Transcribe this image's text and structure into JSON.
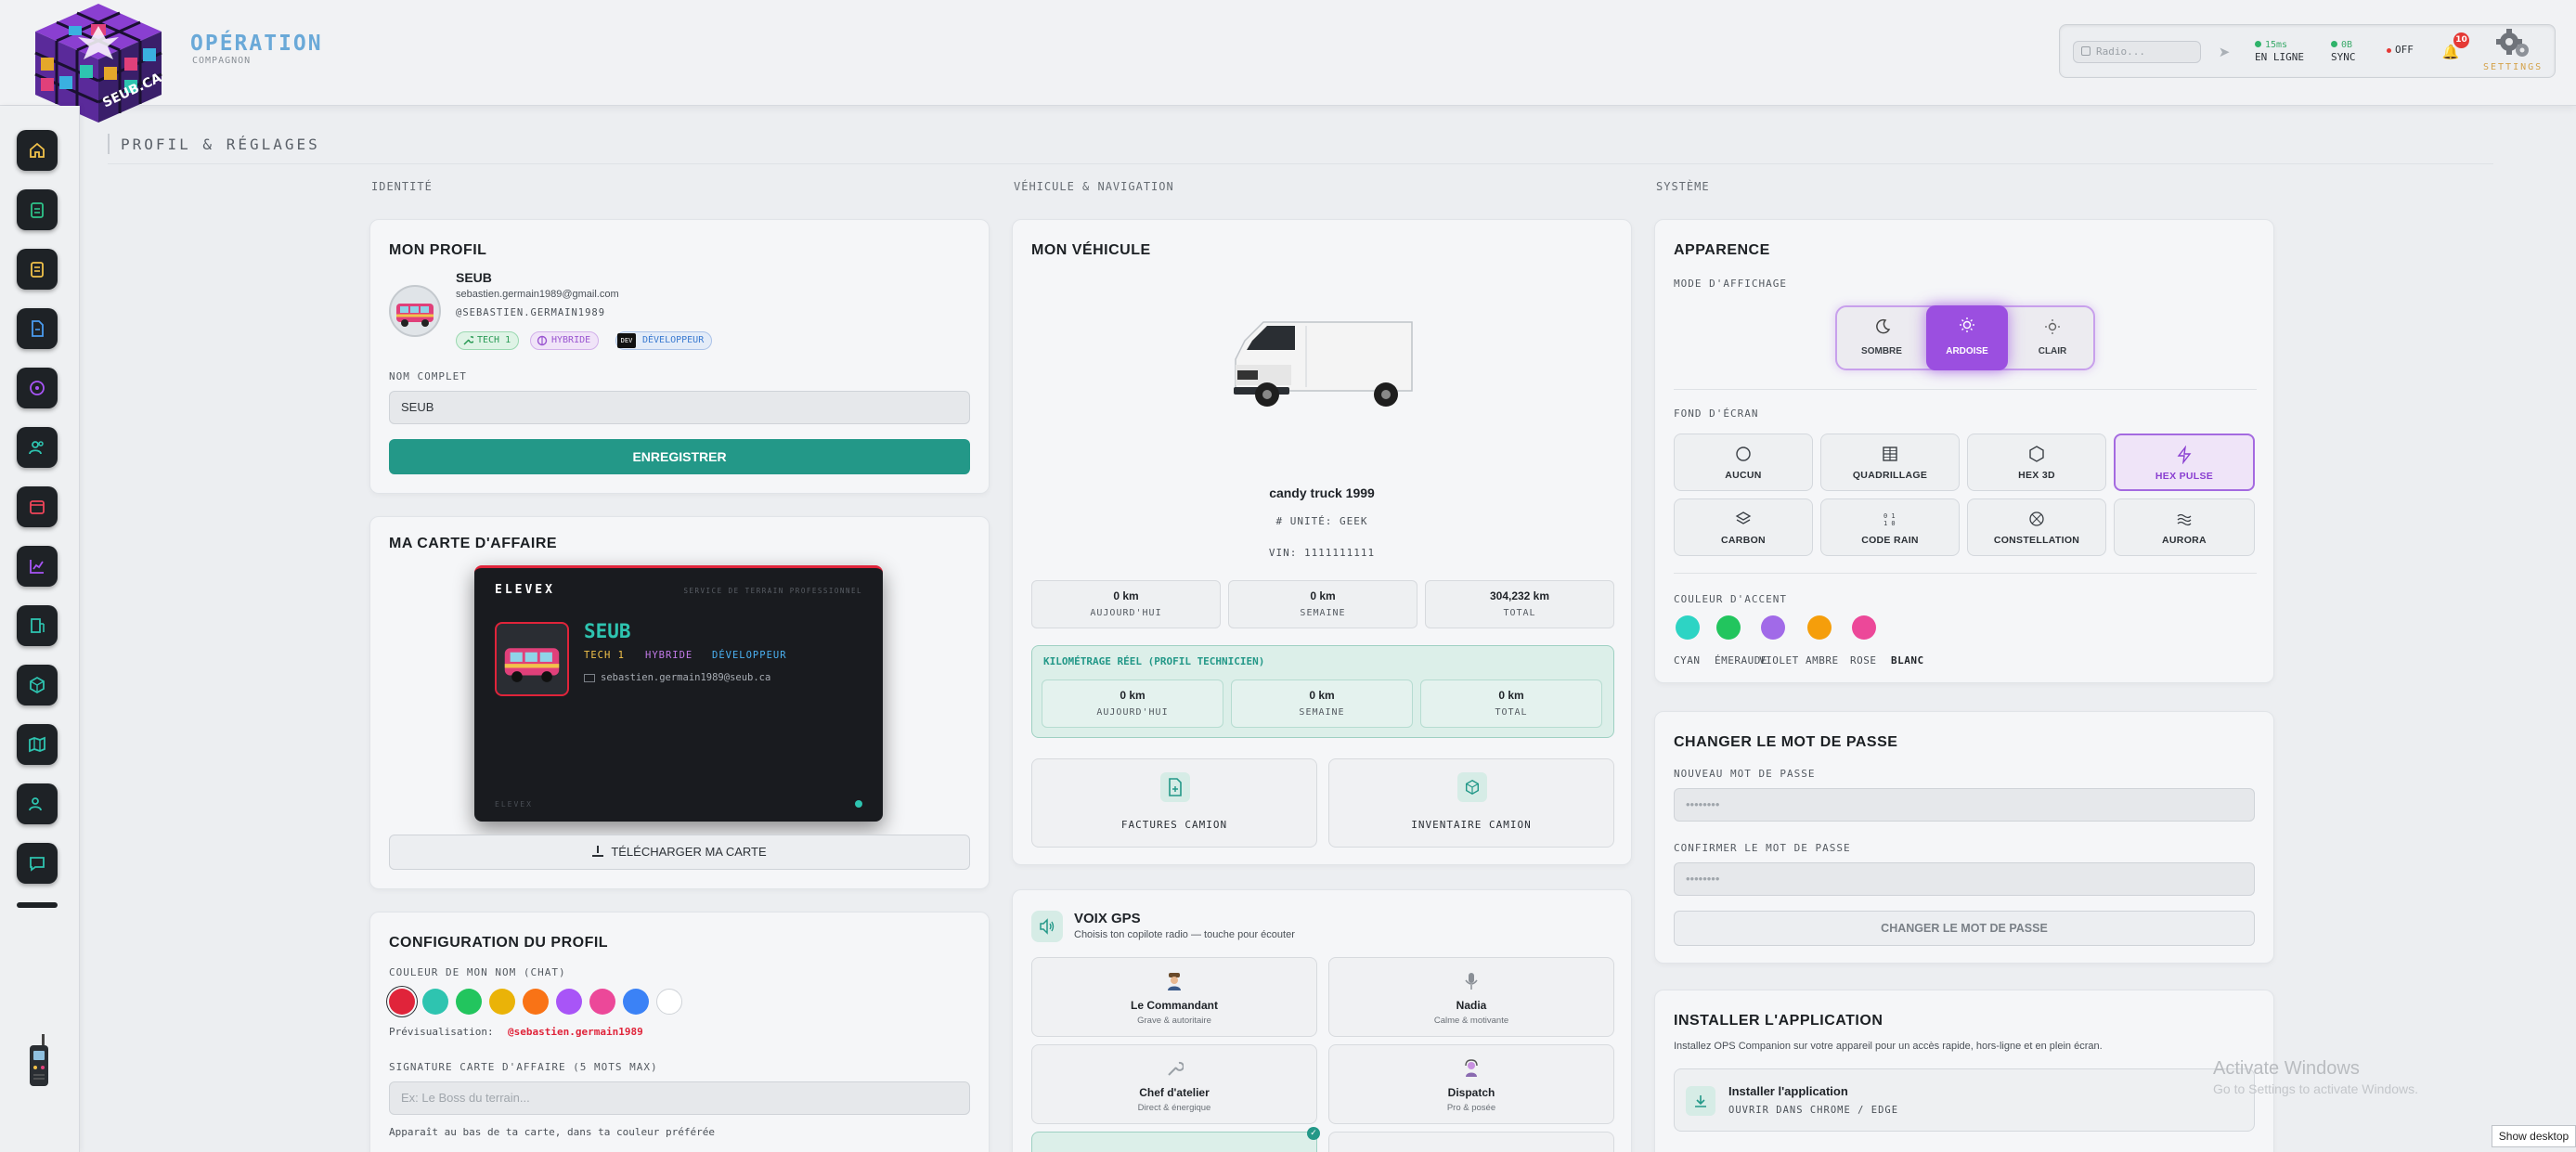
{
  "header": {
    "logo_text": "SEUB.CA",
    "app_title": "OPÉRATION",
    "app_subtitle": "COMPAGNON",
    "radio_placeholder": "Radio...",
    "status": [
      {
        "number": "15ms",
        "label": "EN LIGNE",
        "color": "#2fb36a"
      },
      {
        "number": "0B",
        "label": "SYNC",
        "color": "#2fb36a"
      },
      {
        "number": "",
        "label": "OFF",
        "color": "#e53935"
      }
    ],
    "notifications": "10",
    "settings_label": "SETTINGS"
  },
  "page": {
    "title": "PROFIL & RÉGLAGES"
  },
  "columns": {
    "identity": "IDENTITÉ",
    "vehicle": "VÉHICULE & NAVIGATION",
    "system": "SYSTÈME"
  },
  "profile": {
    "title": "MON PROFIL",
    "name": "SEUB",
    "email": "sebastien.germain1989@gmail.com",
    "handle": "@SEBASTIEN.GERMAIN1989",
    "badges": [
      "TECH 1",
      "HYBRIDE",
      "DÉVELOPPEUR"
    ],
    "dev_icon": "DEV",
    "fullname_label": "NOM COMPLET",
    "fullname_value": "SEUB",
    "save_label": "ENREGISTRER"
  },
  "business_card": {
    "title": "MA CARTE D'AFFAIRE",
    "brand": "ELEVEX",
    "service": "SERVICE DE TERRAIN PROFESSIONNEL",
    "name": "SEUB",
    "tags": [
      "TECH 1",
      "HYBRIDE",
      "DÉVELOPPEUR"
    ],
    "email": "sebastien.germain1989@seub.ca",
    "footer": "ELEVEX",
    "download_label": "TÉLÉCHARGER MA CARTE"
  },
  "profile_config": {
    "title": "CONFIGURATION DU PROFIL",
    "name_color_label": "COULEUR DE MON NOM (CHAT)",
    "colors": [
      "#e0243a",
      "#2ec4b0",
      "#22c55e",
      "#eab308",
      "#f97316",
      "#a855f7",
      "#ec4899",
      "#3b82f6",
      "#ffffff"
    ],
    "preview_label": "Prévisualisation:",
    "preview_value": "@sebastien.germain1989",
    "signature_label": "SIGNATURE CARTE D'AFFAIRE (5 MOTS MAX)",
    "signature_placeholder": "Ex: Le Boss du terrain...",
    "signature_hint": "Apparaît au bas de ta carte, dans ta couleur préférée"
  },
  "vehicle": {
    "title": "MON VÉHICULE",
    "name": "candy truck 1999",
    "unit": "# UNITÉ: GEEK",
    "vin": "VIN: 1111111111",
    "stats": [
      {
        "value": "0 km",
        "label": "AUJOURD'HUI"
      },
      {
        "value": "0 km",
        "label": "SEMAINE"
      },
      {
        "value": "304,232 km",
        "label": "TOTAL"
      }
    ],
    "real_title": "KILOMÉTRAGE RÉEL (PROFIL TECHNICIEN)",
    "real_stats": [
      {
        "value": "0 km",
        "label": "AUJOURD'HUI"
      },
      {
        "value": "0 km",
        "label": "SEMAINE"
      },
      {
        "value": "0 km",
        "label": "TOTAL"
      }
    ],
    "actions": [
      "FACTURES CAMION",
      "INVENTAIRE CAMION"
    ]
  },
  "gps_voice": {
    "title": "VOIX GPS",
    "subtitle": "Choisis ton copilote radio — touche pour écouter",
    "voices": [
      {
        "name": "Le Commandant",
        "desc": "Grave & autoritaire"
      },
      {
        "name": "Nadia",
        "desc": "Calme & motivante"
      },
      {
        "name": "Chef d'atelier",
        "desc": "Direct & énergique"
      },
      {
        "name": "Dispatch",
        "desc": "Pro & posée"
      }
    ]
  },
  "appearance": {
    "title": "APPARENCE",
    "mode_label": "MODE D'AFFICHAGE",
    "modes": [
      "SOMBRE",
      "ARDOISE",
      "CLAIR"
    ],
    "active_mode": "ARDOISE",
    "wallpaper_label": "FOND D'ÉCRAN",
    "wallpapers": [
      "AUCUN",
      "QUADRILLAGE",
      "HEX 3D",
      "HEX PULSE",
      "CARBON",
      "CODE RAIN",
      "CONSTELLATION",
      "AURORA"
    ],
    "active_wallpaper": "HEX PULSE",
    "accent_label": "COULEUR D'ACCENT",
    "accents": [
      {
        "name": "CYAN",
        "color": "#2dd4c4"
      },
      {
        "name": "ÉMERAUDE",
        "color": "#22c55e"
      },
      {
        "name": "VIOLET",
        "color": "#a16ae8"
      },
      {
        "name": "AMBRE",
        "color": "#f59e0b"
      },
      {
        "name": "ROSE",
        "color": "#ec4899"
      },
      {
        "name": "BLANC",
        "color": ""
      }
    ]
  },
  "password": {
    "title": "CHANGER LE MOT DE PASSE",
    "new_label": "NOUVEAU MOT DE PASSE",
    "new_placeholder": "••••••••",
    "confirm_label": "CONFIRMER LE MOT DE PASSE",
    "confirm_placeholder": "••••••••",
    "button": "CHANGER LE MOT DE PASSE"
  },
  "install": {
    "title": "INSTALLER L'APPLICATION",
    "desc": "Installez OPS Companion sur votre appareil pour un accès rapide, hors-ligne et en plein écran.",
    "button_title": "Installer l'application",
    "button_sub": "OUVRIR DANS CHROME / EDGE"
  },
  "os": {
    "watermark_title": "Activate Windows",
    "watermark_sub": "Go to Settings to activate Windows.",
    "show_desktop": "Show desktop"
  },
  "colors": {
    "accent": "#239888",
    "violet": "#9b4fe0"
  }
}
